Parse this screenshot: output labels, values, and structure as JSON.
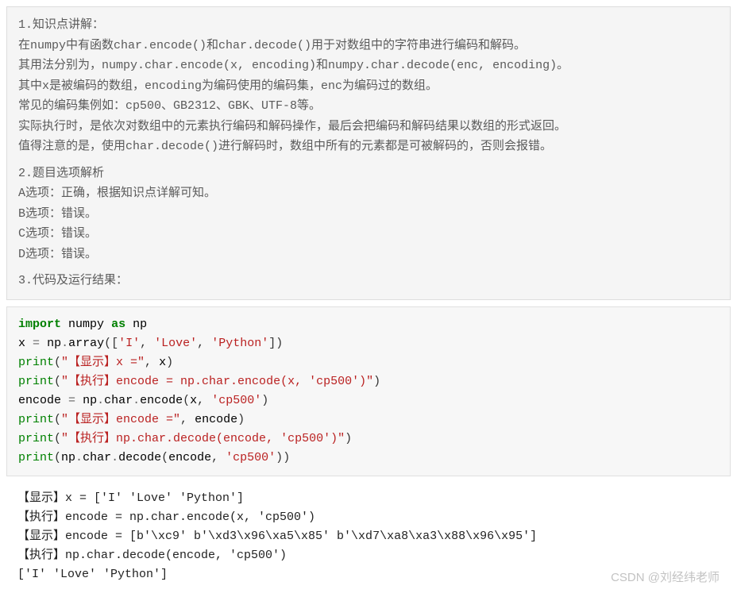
{
  "explanation": {
    "lines": [
      "1.知识点讲解：",
      "在numpy中有函数char.encode()和char.decode()用于对数组中的字符串进行编码和解码。",
      "其用法分别为，numpy.char.encode(x, encoding)和numpy.char.decode(enc, encoding)。",
      "其中x是被编码的数组，encoding为编码使用的编码集，enc为编码过的数组。",
      "常见的编码集例如：cp500、GB2312、GBK、UTF-8等。",
      "实际执行时，是依次对数组中的元素执行编码和解码操作，最后会把编码和解码结果以数组的形式返回。",
      "值得注意的是，使用char.decode()进行解码时，数组中所有的元素都是可被解码的，否则会报错。",
      "",
      "2.题目选项解析",
      "A选项：正确，根据知识点详解可知。",
      "B选项：错误。",
      "C选项：错误。",
      "D选项：错误。",
      "",
      "3.代码及运行结果："
    ]
  },
  "code": {
    "l1": {
      "kw_import": "import",
      "module": "numpy",
      "kw_as": "as",
      "alias": "np"
    },
    "l2": {
      "var": "x",
      "eq": "=",
      "np": "np",
      "dot": ".",
      "array": "array",
      "lp": "([",
      "s1": "'I'",
      "c": ", ",
      "s2": "'Love'",
      "s3": "'Python'",
      "rp": "])"
    },
    "l3": {
      "print": "print",
      "lp": "(",
      "str": "\"【显示】x =\"",
      "c": ", ",
      "arg": "x",
      "rp": ")"
    },
    "l4": {
      "print": "print",
      "lp": "(",
      "str": "\"【执行】encode = np.char.encode(x, 'cp500')\"",
      "rp": ")"
    },
    "l5": {
      "var": "encode",
      "eq": "=",
      "np": "np",
      "d1": ".",
      "char": "char",
      "d2": ".",
      "encode": "encode",
      "lp": "(",
      "a1": "x",
      "c": ", ",
      "s": "'cp500'",
      "rp": ")"
    },
    "l6": {
      "print": "print",
      "lp": "(",
      "str": "\"【显示】encode =\"",
      "c": ", ",
      "arg": "encode",
      "rp": ")"
    },
    "l7": {
      "print": "print",
      "lp": "(",
      "str": "\"【执行】np.char.decode(encode, 'cp500')\"",
      "rp": ")"
    },
    "l8": {
      "print": "print",
      "lp": "(",
      "np": "np",
      "d1": ".",
      "char": "char",
      "d2": ".",
      "decode": "decode",
      "lp2": "(",
      "a1": "encode",
      "c": ", ",
      "s": "'cp500'",
      "rp2": ")",
      "rp": ")"
    }
  },
  "output": {
    "lines": [
      "【显示】x = ['I' 'Love' 'Python']",
      "【执行】encode = np.char.encode(x, 'cp500')",
      "【显示】encode = [b'\\xc9' b'\\xd3\\x96\\xa5\\x85' b'\\xd7\\xa8\\xa3\\x88\\x96\\x95']",
      "【执行】np.char.decode(encode, 'cp500')",
      "['I' 'Love' 'Python']"
    ]
  },
  "watermark": "CSDN @刘经纬老师"
}
